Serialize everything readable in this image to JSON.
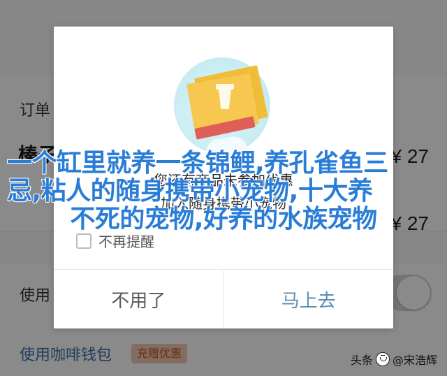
{
  "background": {
    "order_label": "订单",
    "item_title": "榛子",
    "prices": [
      "¥ 27",
      "¥ 27"
    ],
    "use_label": "使用",
    "wallet_label": "使用咖啡钱包",
    "wallet_badge": "充赠优惠",
    "toggle_state": "on"
  },
  "modal": {
    "line1": "您还有商品未参加优惠",
    "line2": "加入随身携带小宠物",
    "checkbox_label": "不再提醒",
    "cancel_label": "不用了",
    "confirm_label": "马上去"
  },
  "headline": {
    "line1": "一个缸里就养一条锦鲤,养孔雀鱼三",
    "line2": "忌,粘人的随身携带小宠物,十大养",
    "line3": "不死的宠物,好养的水族宠物"
  },
  "watermark": {
    "brand": "头条",
    "name": "@宋浩辉"
  },
  "colors": {
    "headline": "#2a7dd6",
    "confirm": "#5b8eb5",
    "badge_bg": "#f2c8b2",
    "badge_text": "#c55525"
  },
  "icons": {
    "hero": "coffee-card-illustration",
    "checkbox": "checkbox-icon",
    "watermark": "toutiao-icon"
  }
}
